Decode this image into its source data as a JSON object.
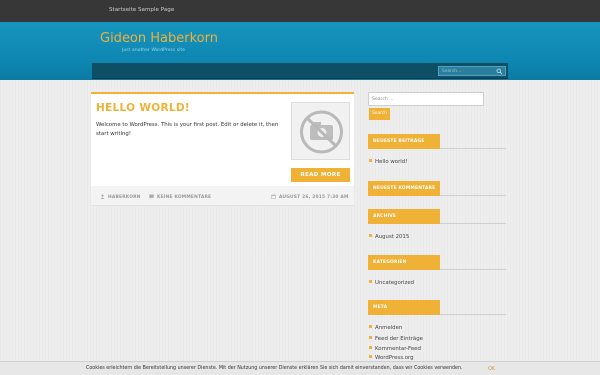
{
  "topnav": {
    "items": [
      "Startseite",
      "Sample Page"
    ]
  },
  "site": {
    "title": "Gideon Haberkorn",
    "description": "Just another WordPress site"
  },
  "nav_search": {
    "placeholder": "Search..."
  },
  "post": {
    "title": "HELLO WORLD!",
    "excerpt": "Welcome to WordPress. This is your first post. Edit or delete it, then start writing!",
    "read_more": "READ MORE",
    "author": "HABERKORN",
    "comments": "KEINE KOMMENTARE",
    "date": "AUGUST 26, 2015 7:30 AM"
  },
  "sidebar": {
    "search_placeholder": "Search ...",
    "search_button": "Search",
    "widgets": [
      {
        "title": "NEUESTE BEITRÄGE",
        "links": [
          "Hello world!"
        ]
      },
      {
        "title": "NEUESTE KOMMENTARE",
        "links": []
      },
      {
        "title": "ARCHIVE",
        "links": [
          "August 2015"
        ]
      },
      {
        "title": "KATEGORIEN",
        "links": [
          "Uncategorized"
        ]
      },
      {
        "title": "META",
        "links": [
          "Anmelden",
          "Feed der Einträge",
          "Kommentar-Feed",
          "WordPress.org"
        ]
      }
    ]
  },
  "cookie": {
    "text": "Cookies erleichtern die Bereitstellung unserer Dienste. Mit der Nutzung unserer Dienste erklären Sie sich damit einverstanden, dass wir Cookies verwenden.",
    "ok": "OK"
  },
  "colors": {
    "accent": "#f0b137",
    "header": "#0d86b1",
    "topbar": "#373737"
  }
}
